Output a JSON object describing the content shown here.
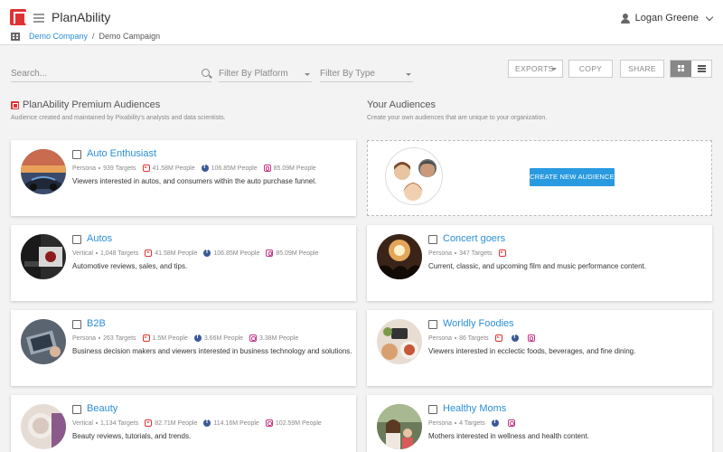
{
  "app": {
    "title": "PlanAbility",
    "brand_color": "#e03232",
    "accent_color": "#2a8fd6"
  },
  "user": {
    "name": "Logan Greene"
  },
  "breadcrumb": {
    "company": "Demo Company",
    "separator": "/",
    "campaign": "Demo Campaign"
  },
  "toolbar": {
    "search_placeholder": "Search...",
    "filter_platform": "Filter By Platform",
    "filter_type": "Filter By Type",
    "exports_label": "EXPORTS",
    "copy_label": "COPY",
    "share_label": "SHARE",
    "view_mode": "grid"
  },
  "premium": {
    "title": "PlanAbility Premium Audiences",
    "subtitle": "Audience created and maintained by Pixability's analysts and data scientists."
  },
  "yours": {
    "title": "Your Audiences",
    "subtitle": "Create your own audiences that are unique to your organization.",
    "create_label": "CREATE NEW AUDIENCE"
  },
  "premium_cards": [
    {
      "title": "Auto Enthusiast",
      "type": "Persona",
      "targets": "939 Targets",
      "yt": "41.58M People",
      "fb": "106.85M People",
      "ig": "85.09M People",
      "desc": "Viewers interested in autos, and consumers within the auto purchase funnel."
    },
    {
      "title": "Autos",
      "type": "Vertical",
      "targets": "1,048 Targets",
      "yt": "41.58M People",
      "fb": "106.85M People",
      "ig": "85.09M People",
      "desc": "Automotive reviews, sales, and tips."
    },
    {
      "title": "B2B",
      "type": "Persona",
      "targets": "263 Targets",
      "yt": "1.5M People",
      "fb": "3.66M People",
      "ig": "3.38M People",
      "desc": "Business decision makers and viewers interested in business technology and solutions."
    },
    {
      "title": "Beauty",
      "type": "Vertical",
      "targets": "1,134 Targets",
      "yt": "82.71M People",
      "fb": "114.16M People",
      "ig": "102.59M People",
      "desc": "Beauty reviews, tutorials, and trends."
    }
  ],
  "your_cards": [
    {
      "title": "Concert goers",
      "type": "Persona",
      "targets": "347 Targets",
      "desc": "Current, classic, and upcoming film and music performance content."
    },
    {
      "title": "Worldly Foodies",
      "type": "Persona",
      "targets": "86 Targets",
      "desc": "Viewers interested in ecclectic foods, beverages, and fine dining."
    },
    {
      "title": "Healthy Moms",
      "type": "Persona",
      "targets": "4 Targets",
      "desc": "Mothers interested in wellness and health content."
    }
  ]
}
